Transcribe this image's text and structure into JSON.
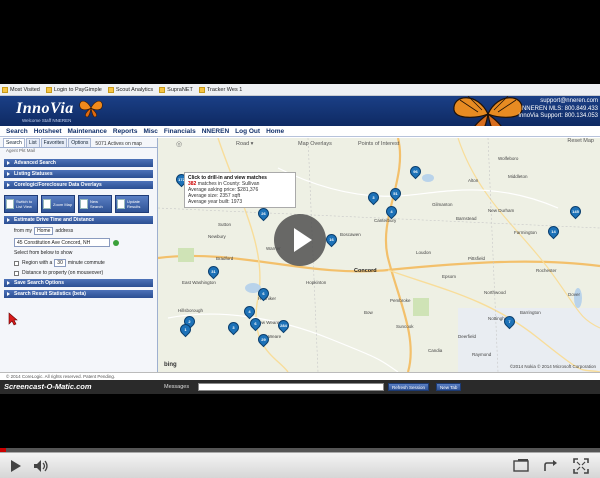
{
  "bookmarks": [
    {
      "label": "Most Visited"
    },
    {
      "label": "Login to PayGimple"
    },
    {
      "label": "Scout Analytics"
    },
    {
      "label": "SupraNET"
    },
    {
      "label": "Tracker Wes 1"
    }
  ],
  "header": {
    "logo": "InnoVia",
    "tagline": "Welcome Staff NNEREN",
    "email": "support@nneren.com",
    "line1": "NNEREN MLS: 800.849.433",
    "line2": "InnoVia Support: 800.134.053"
  },
  "nav": [
    "Search",
    "Hotsheet",
    "Maintenance",
    "Reports",
    "Misc",
    "Financials",
    "NNEREN",
    "Log Out",
    "Home"
  ],
  "left": {
    "tabs": [
      "Search",
      "List",
      "Favorites",
      "Options"
    ],
    "tab_note": "5071 Actives on map",
    "subtabs": "Agent  Pkt  Mail",
    "sections_top": [
      "Advanced Search",
      "Listing Statuses",
      "Corelogic/Foreclosure Data Overlays"
    ],
    "buttons": [
      {
        "label": "Switch to List View"
      },
      {
        "label": "Zoom Map"
      },
      {
        "label": "New Search"
      },
      {
        "label": "Update Results"
      }
    ],
    "drive_section": "Estimate Drive Time and Distance",
    "from_my": "from my",
    "from_value": "Home",
    "address_label": "address",
    "address_value": "45 Constitution Ave Concord, NH",
    "select_label": "Select from below to show",
    "region_label": "Region with a",
    "region_value": "30",
    "region_suffix": "minute commute",
    "distance_label": "Distance to property (on mouseover)",
    "sections_bottom": [
      "Save Search Options",
      "Search Result Statistics (beta)"
    ],
    "footer": "© 2014 CoreLogic. All rights reserved. Patent Pending."
  },
  "map": {
    "road": "Road",
    "overlay": "Map Overlays",
    "poi": "Points of Interest",
    "reset": "Reset Map",
    "tip_title": "Click to drill-in and view matches",
    "tip_count": "382",
    "tip_count_text": "matches in County: Sullivan",
    "tip_line2": "Average asking price: $281,376",
    "tip_line3": "Average size: 2357 sqft",
    "tip_line4": "Average year built: 1973",
    "bing": "bing",
    "copyright": "©2014 Nokia  © 2014 Microsoft Corporation",
    "towns": {
      "t1": "Newbury",
      "t2": "Sutton",
      "t3": "Bradford",
      "t4": "Boscawen",
      "t5": "Concord",
      "t6": "Hopkinton",
      "t7": "Pittsfield",
      "t8": "Epsom",
      "t9": "Loudon",
      "t10": "Canterbury",
      "t11": "Gilmanton",
      "t12": "Barnstead",
      "t13": "Alton",
      "t14": "New Durham",
      "t15": "Farmington",
      "t16": "Rochester",
      "t17": "Barrington",
      "t18": "Nottingham",
      "t19": "Deerfield",
      "t20": "Raymond",
      "t21": "Candia",
      "t22": "Weare",
      "t23": "Henniker",
      "t24": "Hillsborough",
      "t25": "Bow",
      "t26": "Pembroke",
      "t27": "Suncook",
      "t28": "Dover",
      "t29": "Northwood",
      "t30": "East Washington",
      "t31": "Warner",
      "t32": "New Weare",
      "t33": "Middleton",
      "t34": "Wolfeboro"
    },
    "pins": [
      "172",
      "51",
      "26",
      "16",
      "31",
      "6",
      "4",
      "6",
      "3",
      "2",
      "284",
      "29",
      "145",
      "14",
      "7",
      "3",
      "4",
      "96",
      "1"
    ]
  },
  "status": "© 2014 CoreLogic. All rights reserved. Patent Pending.",
  "messages": {
    "watermark": "Screencast-O-Matic.com",
    "label": "Messages",
    "refresh": "Refresh Session",
    "newtab": "New Tab"
  },
  "player": {
    "progress_fraction": 0.01
  }
}
